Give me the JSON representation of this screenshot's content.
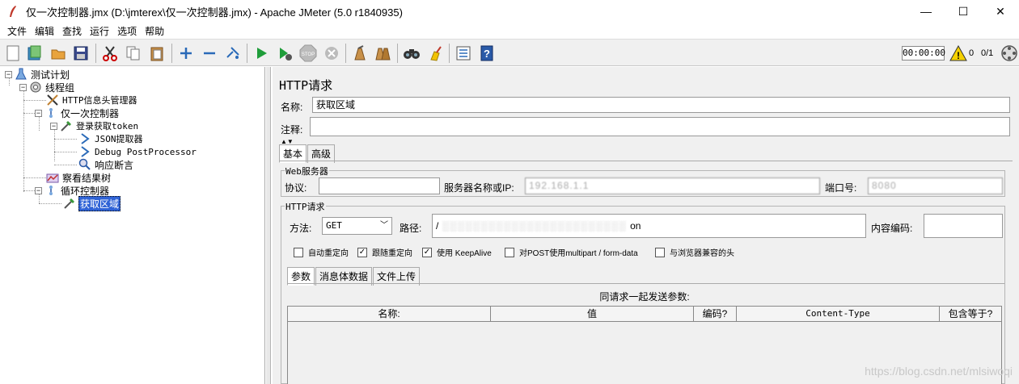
{
  "window": {
    "title": "仅一次控制器.jmx (D:\\jmterex\\仅一次控制器.jmx) - Apache JMeter (5.0 r1840935)",
    "minimize": "—",
    "maximize": "☐",
    "close": "✕"
  },
  "menu": [
    "文件",
    "编辑",
    "查找",
    "运行",
    "选项",
    "帮助"
  ],
  "toolbar": {
    "timer": "00:00:00",
    "warning_count": "0",
    "threads": "0/1",
    "icons": [
      "new-icon",
      "templates-icon",
      "open-icon",
      "save-icon",
      "cut-icon",
      "copy-icon",
      "paste-icon",
      "expand-icon",
      "collapse-icon",
      "toggle-icon",
      "start-icon",
      "start-no-pause-icon",
      "stop-icon",
      "shutdown-icon",
      "clear-icon",
      "clear-all-icon",
      "search-icon",
      "reset-search-icon",
      "function-helper-icon",
      "help-icon"
    ]
  },
  "tree": {
    "items": [
      {
        "label": "测试计划",
        "icon": "test-plan-icon"
      },
      {
        "label": "线程组",
        "icon": "thread-group-icon"
      },
      {
        "label": "HTTP信息头管理器",
        "icon": "header-manager-icon"
      },
      {
        "label": "仅一次控制器",
        "icon": "controller-icon"
      },
      {
        "label": "登录获取token",
        "icon": "sampler-icon"
      },
      {
        "label": "JSON提取器",
        "icon": "extractor-icon"
      },
      {
        "label": "Debug PostProcessor",
        "icon": "postprocessor-icon"
      },
      {
        "label": "响应断言",
        "icon": "assertion-icon"
      },
      {
        "label": "察看结果树",
        "icon": "listener-icon"
      },
      {
        "label": "循环控制器",
        "icon": "controller-icon"
      },
      {
        "label": "获取区域",
        "icon": "sampler-icon"
      }
    ]
  },
  "panel": {
    "title": "HTTP请求",
    "name_label": "名称:",
    "name_value": "获取区域",
    "comment_label": "注释:",
    "comment_value": "",
    "tabs": [
      "基本",
      "高级"
    ],
    "web_server": {
      "title": "Web服务器",
      "protocol_label": "协议:",
      "protocol_value": "",
      "server_label": "服务器名称或IP:",
      "server_value": "192.168.1.1",
      "port_label": "端口号:",
      "port_value": "8080"
    },
    "http_request": {
      "title": "HTTP请求",
      "method_label": "方法:",
      "method_value": "GET",
      "path_label": "路径:",
      "path_value": "/",
      "path_tail": "on",
      "encoding_label": "内容编码:",
      "encoding_value": ""
    },
    "checkboxes": [
      {
        "label": "自动重定向",
        "checked": false
      },
      {
        "label": "跟随重定向",
        "checked": true
      },
      {
        "label": "使用 KeepAlive",
        "checked": true
      },
      {
        "label": "对POST使用multipart / form-data",
        "checked": false
      },
      {
        "label": "与浏览器兼容的头",
        "checked": false
      }
    ],
    "sub_tabs": [
      "参数",
      "消息体数据",
      "文件上传"
    ],
    "params_caption": "同请求一起发送参数:",
    "columns": [
      "名称:",
      "值",
      "编码?",
      "Content-Type",
      "包含等于?"
    ]
  },
  "watermark": "https://blog.csdn.net/mlsiwoqi"
}
